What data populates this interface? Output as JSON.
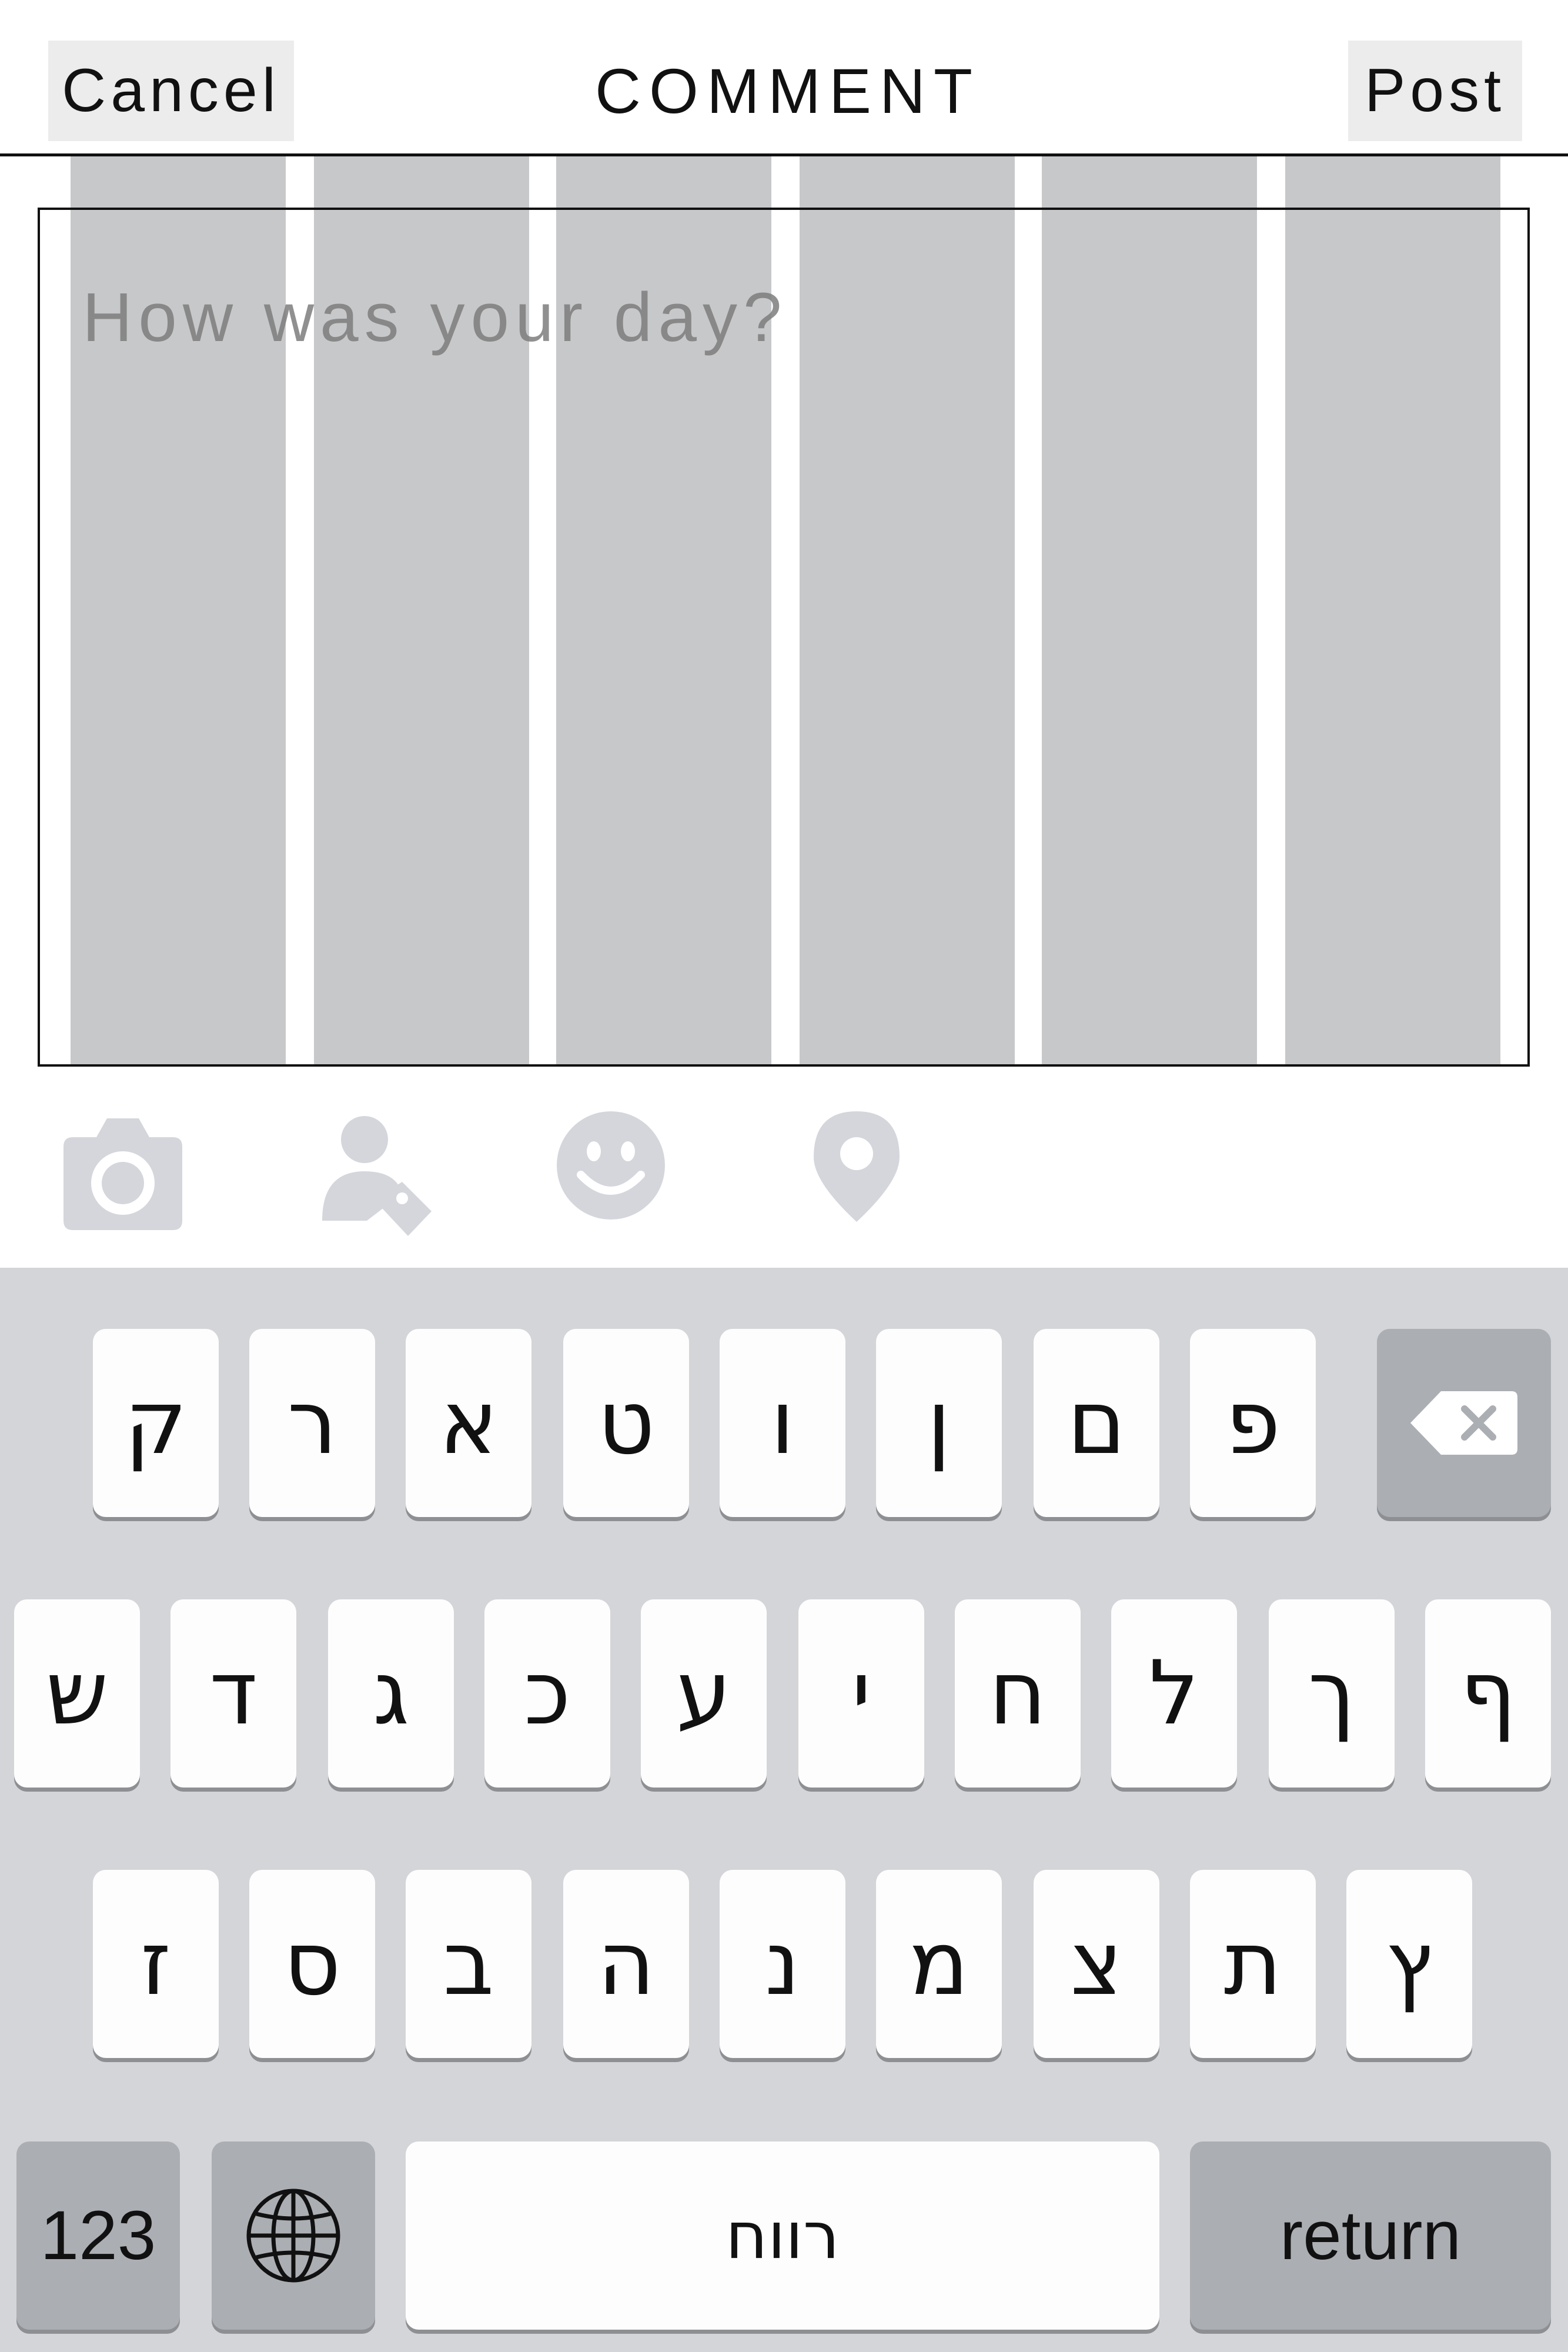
{
  "header": {
    "cancel_label": "Cancel",
    "title": "COMMENT",
    "post_label": "Post"
  },
  "comment": {
    "placeholder": "How was your day?"
  },
  "toolbar": {
    "icons": [
      "camera-icon",
      "tag-person-icon",
      "smiley-icon",
      "location-pin-icon"
    ],
    "icon_color": "#d4d6db"
  },
  "keyboard": {
    "rows": [
      [
        "ק",
        "ר",
        "א",
        "ט",
        "ו",
        "ן",
        "ם",
        "פ"
      ],
      [
        "ש",
        "ד",
        "ג",
        "כ",
        "ע",
        "י",
        "ח",
        "ל",
        "ך",
        "ף"
      ],
      [
        "ז",
        "ס",
        "ב",
        "ה",
        "נ",
        "מ",
        "צ",
        "ת",
        "ץ"
      ]
    ],
    "numbers_label": "123",
    "space_label": "רווח",
    "return_label": "return",
    "backspace_icon": "backspace-icon",
    "globe_icon": "globe-icon"
  },
  "colors": {
    "grid_column": "#c7c8ca",
    "keyboard_bg": "#d4d5d8",
    "key_bg": "#fdfdfd",
    "dark_key_bg": "#abaeb3"
  }
}
